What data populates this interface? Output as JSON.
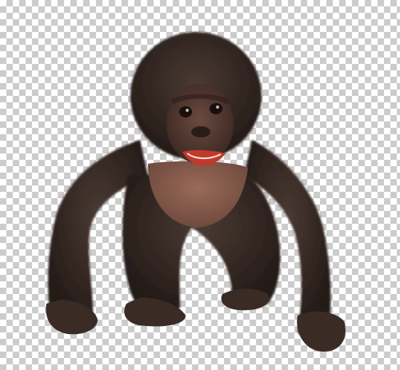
{
  "image": {
    "subject": "baby-bonobo",
    "background": "transparency-checkerboard",
    "colors": {
      "checker_light": "#ffffff",
      "checker_dark": "#cccccc",
      "fur": "#2e2420",
      "fur_light": "#4a3a33",
      "skin": "#8a5f4f",
      "face": "#5a3f36",
      "mouth": "#c0392b",
      "eye": "#1a0f0c"
    }
  }
}
